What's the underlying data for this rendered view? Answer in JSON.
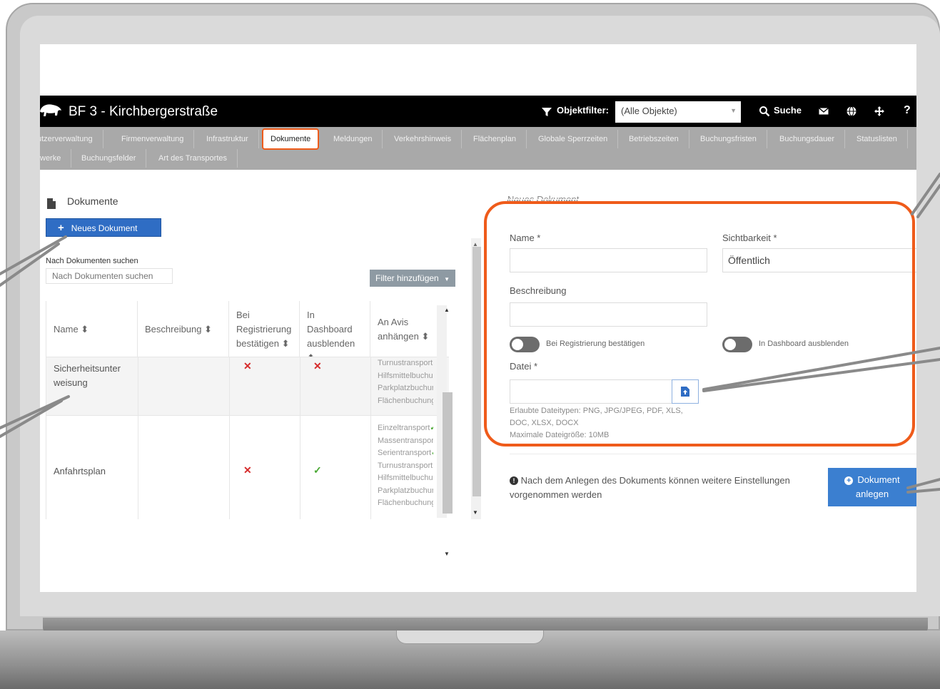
{
  "header": {
    "title": "BF 3 - Kirchbergerstraße",
    "filter_label": "Objektfilter:",
    "filter_value": "(Alle Objekte)",
    "search_label": "Suche",
    "help": "?"
  },
  "nav": {
    "row1": [
      "utzerverwaltung",
      "Firmenverwaltung",
      "Infrastruktur",
      "Dokumente",
      "Meldungen",
      "Verkehrshinweis",
      "Flächenplan",
      "Globale Sperrzeiten",
      "Betriebszeiten",
      "Buchungsfristen",
      "Buchungsdauer",
      "Statuslisten"
    ],
    "row2": [
      "werke",
      "Buchungsfelder",
      "Art des Transportes"
    ],
    "active": "Dokumente"
  },
  "left": {
    "title": "Dokumente",
    "new_button": "Neues Dokument",
    "search_label": "Nach Dokumenten suchen",
    "search_placeholder": "Nach Dokumenten suchen",
    "filter_button": "Filter hinzufügen",
    "columns": [
      "Name ⬍",
      "Beschreibung ⬍",
      "Bei Registrierung bestätigen ⬍",
      "In Dashboard ausblenden ⬍",
      "An Avis anhängen ⬍"
    ],
    "rows": [
      {
        "name": "Sicherheitsunterweisung",
        "beschreibung": "",
        "registrierung": "✕",
        "dashboard": "✕",
        "avis": [
          {
            "text": "Turnustransport",
            "mark": "x"
          },
          {
            "text": "Hilfsmittelbuchung",
            "mark": ""
          },
          {
            "text": "Parkplatzbuchung",
            "mark": "x"
          },
          {
            "text": "Flächenbuchung",
            "mark": "x"
          }
        ]
      },
      {
        "name": "Anfahrtsplan",
        "beschreibung": "",
        "registrierung": "✕",
        "dashboard": "✓",
        "avis": [
          {
            "text": "Einzeltransport",
            "mark": "check"
          },
          {
            "text": "Massentransport",
            "mark": ""
          },
          {
            "text": "Serientransport",
            "mark": "check"
          },
          {
            "text": "Turnustransport",
            "mark": "x"
          },
          {
            "text": "Hilfsmittelbuchung",
            "mark": ""
          },
          {
            "text": "Parkplatzbuchung",
            "mark": ""
          },
          {
            "text": "Flächenbuchung",
            "mark": "x"
          }
        ]
      }
    ]
  },
  "right": {
    "heading": "Neues Dokument",
    "name_label": "Name *",
    "sichtbarkeit_label": "Sichtbarkeit *",
    "sichtbarkeit_value": "Öffentlich",
    "beschreibung_label": "Beschreibung",
    "toggle_registrierung": "Bei Registrierung bestätigen",
    "toggle_dashboard": "In Dashboard ausblenden",
    "datei_label": "Datei *",
    "hint_types_1": "Erlaubte Dateitypen: PNG, JPG/JPEG, PDF, XLS,",
    "hint_types_2": "DOC, XLSX, DOCX",
    "hint_size": "Maximale Dateigröße: 10MB",
    "info": "Nach dem Anlegen des Dokuments können weitere Einstellungen vorgenommen werden",
    "create_line1": "Dokument",
    "create_line2": "anlegen"
  },
  "colors": {
    "accent_orange": "#ef5b1a",
    "primary_blue": "#2f6dc4",
    "nav_gray": "#a9a9a9",
    "header_black": "#000000",
    "error_red": "#d62b2b",
    "success_green": "#48a832"
  }
}
